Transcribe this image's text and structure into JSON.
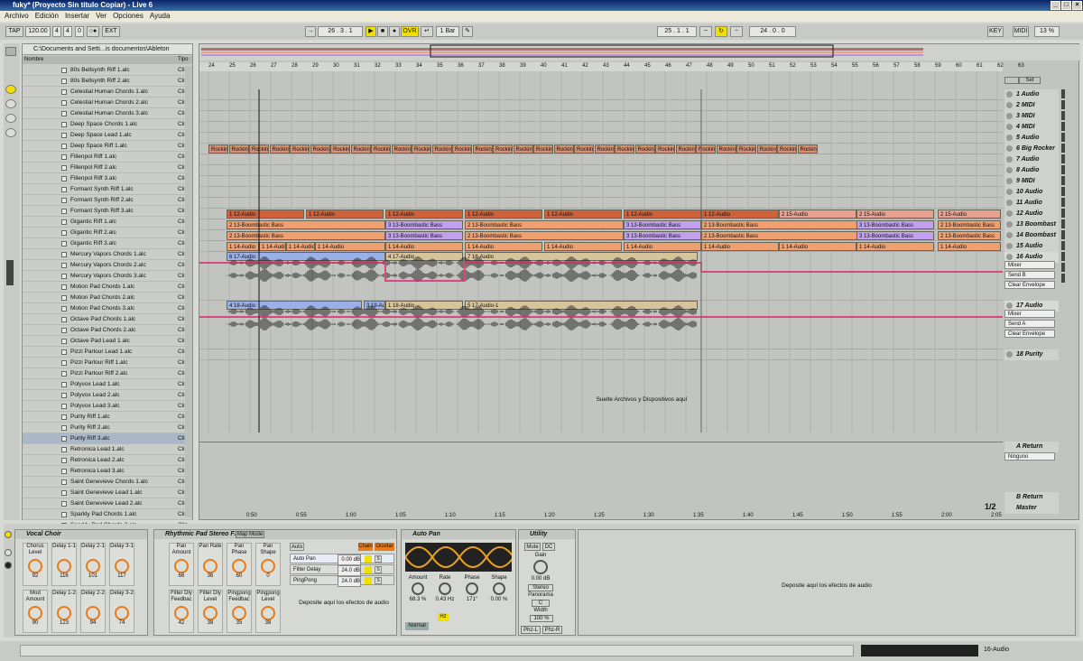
{
  "title": "fuky* (Proyecto Sin título Copiar) - Live 6",
  "menu": [
    "Archivo",
    "Edición",
    "Insertar",
    "Ver",
    "Opciones",
    "Ayuda"
  ],
  "transport": {
    "tap": "TAP",
    "tempo": "120.00",
    "sig_num": "4",
    "sig_den": "4",
    "quant": "0",
    "ext": "EXT",
    "pos": "26 . 3 . 1",
    "ovr": "OVR",
    "bar": "1 Bar",
    "loop_start": "25 . 1 . 1",
    "loop_len": "24 . 0 . 0",
    "key": "KEY",
    "midi": "MIDI",
    "cpu": "13 %"
  },
  "browser": {
    "path": "C:\\Documents and Setti...is documentos\\Ableton",
    "col_name": "Nombre",
    "col_type": "Tipo",
    "files": [
      "80s Bellsynth Riff 1.alc",
      "80s Bellsynth Riff 2.alc",
      "Celestial Human Chords 1.alc",
      "Celestial Human Chords 2.alc",
      "Celestial Human Chords 3.alc",
      "Deep Space Chords 1.alc",
      "Deep Space Lead 1.alc",
      "Deep Space Riff 1.alc",
      "Fillenpol Riff 1.alc",
      "Fillenpol Riff 2.alc",
      "Fillenpol Riff 3.alc",
      "Formant Synth Riff 1.alc",
      "Formant Synth Riff 2.alc",
      "Formant Synth Riff 3.alc",
      "Gigantic Riff 1.alc",
      "Gigantic Riff 2.alc",
      "Gigantic Riff 3.alc",
      "Mercury Vapors Chords 1.alc",
      "Mercury Vapors Chords 2.alc",
      "Mercury Vapors Chords 3.alc",
      "Motion Pad Chords 1.alc",
      "Motion Pad Chords 2.alc",
      "Motion Pad Chords 3.alc",
      "Octave Pad Chords 1.alc",
      "Octave Pad Chords 2.alc",
      "Octave Pad Lead 1.alc",
      "Pizzi Parlour Lead 1.alc",
      "Pizzi Parlour Riff 1.alc",
      "Pizzi Parlour Riff 2.alc",
      "Polyvox Lead 1.alc",
      "Polyvox Lead 2.alc",
      "Polyvox Lead 3.alc",
      "Purity Riff 1.alc",
      "Purity Riff 2.alc",
      "Purity Riff 3.alc",
      "Retronica Lead 1.alc",
      "Retronica Lead 2.alc",
      "Retronica Lead 3.alc",
      "Saint Genevieve Chords 1.alc",
      "Saint Genevieve Lead 1.alc",
      "Saint Genevieve Lead 2.alc",
      "Sparkly Pad Chords 1.alc",
      "Sparkly Pad Chords 2.alc"
    ],
    "type_label": "Clip"
  },
  "ruler": [
    "24",
    "25",
    "26",
    "27",
    "28",
    "29",
    "30",
    "31",
    "32",
    "33",
    "34",
    "35",
    "36",
    "37",
    "38",
    "39",
    "40",
    "41",
    "42",
    "43",
    "44",
    "45",
    "46",
    "47",
    "48",
    "49",
    "50",
    "51",
    "52",
    "53",
    "54",
    "55",
    "56",
    "57",
    "58",
    "59",
    "60",
    "61",
    "62",
    "63"
  ],
  "timeline": [
    "0:50",
    "0:55",
    "1:00",
    "1:05",
    "1:10",
    "1:15",
    "1:20",
    "1:25",
    "1:30",
    "1:35",
    "1:40",
    "1:45",
    "1:50",
    "1:55",
    "2:00",
    "2:05"
  ],
  "tracks": [
    "1 Audio",
    "2 MIDI",
    "3 MIDI",
    "4 MIDI",
    "5 Audio",
    "6 Big Rocker",
    "7 Audio",
    "8 Audio",
    "9 MIDI",
    "10 Audio",
    "11 Audio",
    "12 Audio",
    "13 Boombast",
    "14 Boombast",
    "15 Audio",
    "16 Audio",
    "17 Audio",
    "18 Purity"
  ],
  "return_tracks": [
    "A Return",
    "B Return",
    "Master"
  ],
  "set_label": "Set",
  "track16": {
    "mixer": "Mixer",
    "send": "Send B",
    "clear": "Clear Envelope"
  },
  "track17": {
    "mixer": "Mixer",
    "send": "Send A",
    "clear": "Clear Envelope"
  },
  "returnA_input": "Ninguno",
  "drop_text": "Suelte Archivos y Dispositivos aquí",
  "page": "1/2",
  "clips": {
    "rockin": "Rockin",
    "a12": "1 12-Audio",
    "a15": "2 15-Audio",
    "b13": "3 13-Boombastic Bass",
    "b13b": "2 13-Boombastic Bass",
    "a14": "1 14-Audio",
    "c17": "6 17-Audio",
    "c17b": "4 17-Audio",
    "c16": "7 16-Audio",
    "c18": "4 18-Audio",
    "c18b": "3 18-Audio",
    "c18c": "1 18-Audio",
    "c171": "5 17-Audio-1"
  },
  "devices": {
    "vocal": {
      "title": "Vocal Choir",
      "knobs": [
        [
          "Chorus Level",
          "92"
        ],
        [
          "Delay 1-1",
          "116"
        ],
        [
          "Delay 2-1",
          "101"
        ],
        [
          "Delay 3-1",
          "117"
        ],
        [
          "Mod Amount",
          "90"
        ],
        [
          "Delay 1-2",
          "123"
        ],
        [
          "Delay 2-2",
          "94"
        ],
        [
          "Delay 3-2",
          "74"
        ]
      ]
    },
    "rhythmic": {
      "title": "Rhythmic Pad Stereo FX",
      "map": "Map Mode",
      "knobs": [
        [
          "Pan Amount",
          "66"
        ],
        [
          "Pan Rate",
          "36"
        ],
        [
          "Pan Phase",
          "60"
        ],
        [
          "Pan Shape",
          "0"
        ],
        [
          "Filter Dly Feedbac",
          "42"
        ],
        [
          "Filter Dly Level",
          "38"
        ],
        [
          "Pingpong Feedbac",
          "35"
        ],
        [
          "Pingpong Level",
          "38"
        ]
      ],
      "auto": "Auto",
      "chain": "Chain",
      "ocultar": "Ocultar",
      "chains": [
        [
          "Auto Pan",
          "0.00 dB"
        ],
        [
          "Filter Delay",
          "24.0 dB"
        ],
        [
          "PingPong",
          "24.0 dB"
        ]
      ],
      "drop": "Deposite aquí los efectos de audio"
    },
    "autopan": {
      "title": "Auto Pan",
      "params": [
        [
          "Amount",
          "68.3 %"
        ],
        [
          "Rate",
          "0.43 Hz"
        ],
        [
          "Phase",
          "171°"
        ],
        [
          "Shape",
          "0.00 %"
        ]
      ],
      "normal": "Normal",
      "hz": "Hz"
    },
    "utility": {
      "title": "Utility",
      "mute": "Mute",
      "dc": "DC",
      "gain": "Gain",
      "gain_val": "0.00 dB",
      "stereo": "Stereo",
      "panorama": "Panorama",
      "pan_val": "C",
      "width": "Width",
      "width_val": "100 %",
      "phl": "Phz-L",
      "phr": "Phz-R"
    },
    "drop": "Deposite aquí los efectos de audio"
  },
  "status": {
    "track": "16-Audio"
  }
}
